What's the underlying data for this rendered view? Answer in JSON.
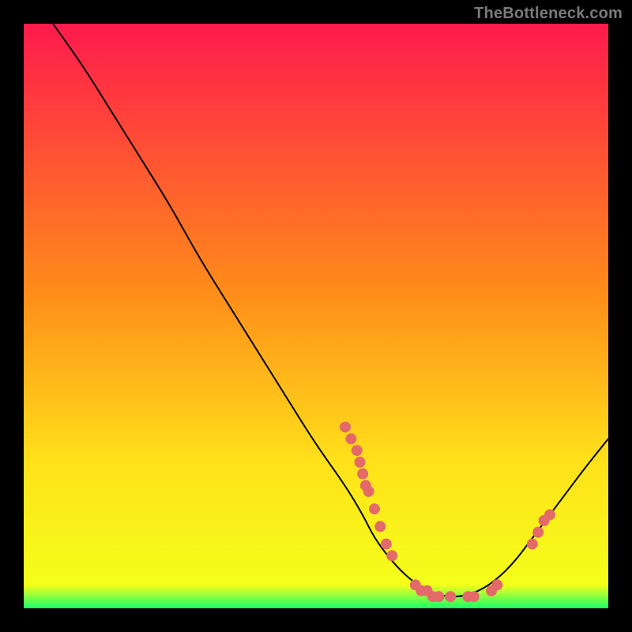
{
  "watermark": "TheBottleneck.com",
  "chart_data": {
    "type": "line",
    "title": "",
    "xlabel": "",
    "ylabel": "",
    "xlim": [
      0,
      100
    ],
    "ylim": [
      0,
      100
    ],
    "gradient": {
      "top_color": "#ff1a4d",
      "mid_color": "#ffe11a",
      "bottom_color": "#1aff66"
    },
    "curve": [
      {
        "x": 5,
        "y": 100
      },
      {
        "x": 10,
        "y": 93
      },
      {
        "x": 15,
        "y": 85
      },
      {
        "x": 20,
        "y": 77
      },
      {
        "x": 25,
        "y": 69
      },
      {
        "x": 30,
        "y": 60
      },
      {
        "x": 35,
        "y": 52
      },
      {
        "x": 40,
        "y": 44
      },
      {
        "x": 45,
        "y": 36
      },
      {
        "x": 50,
        "y": 28
      },
      {
        "x": 55,
        "y": 21
      },
      {
        "x": 58,
        "y": 16
      },
      {
        "x": 60,
        "y": 12
      },
      {
        "x": 63,
        "y": 8
      },
      {
        "x": 66,
        "y": 5
      },
      {
        "x": 69,
        "y": 3
      },
      {
        "x": 72,
        "y": 2
      },
      {
        "x": 75,
        "y": 2
      },
      {
        "x": 78,
        "y": 3
      },
      {
        "x": 81,
        "y": 5
      },
      {
        "x": 84,
        "y": 8
      },
      {
        "x": 87,
        "y": 12
      },
      {
        "x": 90,
        "y": 16
      },
      {
        "x": 93,
        "y": 20
      },
      {
        "x": 96,
        "y": 24
      },
      {
        "x": 100,
        "y": 29
      }
    ],
    "markers": [
      {
        "x": 55,
        "y": 31
      },
      {
        "x": 56,
        "y": 29
      },
      {
        "x": 57,
        "y": 27
      },
      {
        "x": 57.5,
        "y": 25
      },
      {
        "x": 58,
        "y": 23
      },
      {
        "x": 58.5,
        "y": 21
      },
      {
        "x": 59,
        "y": 20
      },
      {
        "x": 60,
        "y": 17
      },
      {
        "x": 61,
        "y": 14
      },
      {
        "x": 62,
        "y": 11
      },
      {
        "x": 63,
        "y": 9
      },
      {
        "x": 67,
        "y": 4
      },
      {
        "x": 68,
        "y": 3
      },
      {
        "x": 69,
        "y": 3
      },
      {
        "x": 70,
        "y": 2
      },
      {
        "x": 71,
        "y": 2
      },
      {
        "x": 73,
        "y": 2
      },
      {
        "x": 76,
        "y": 2
      },
      {
        "x": 77,
        "y": 2
      },
      {
        "x": 80,
        "y": 3
      },
      {
        "x": 81,
        "y": 4
      },
      {
        "x": 87,
        "y": 11
      },
      {
        "x": 88,
        "y": 13
      },
      {
        "x": 89,
        "y": 15
      },
      {
        "x": 90,
        "y": 16
      }
    ],
    "marker_color": "#e46a6a",
    "curve_color": "#000000"
  }
}
